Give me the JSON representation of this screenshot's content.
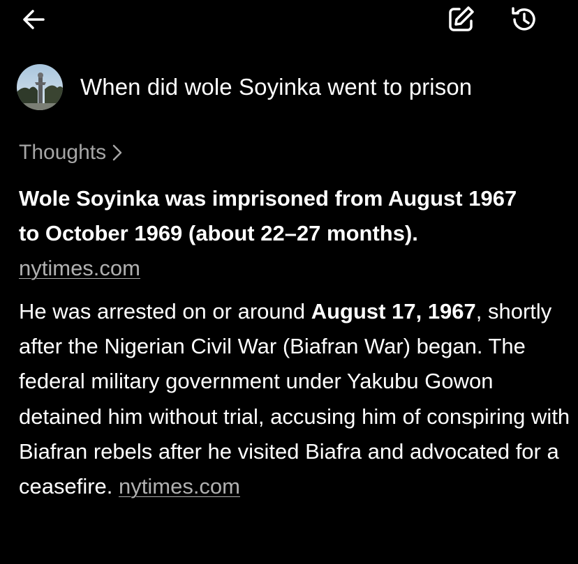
{
  "header": {
    "back_icon": "arrow-left-icon",
    "edit_icon": "edit-square-icon",
    "history_icon": "history-icon"
  },
  "query": {
    "text": "When did wole Soyinka went to prison"
  },
  "thoughts": {
    "label": "Thoughts",
    "icon": "chevron-right-icon"
  },
  "answer": {
    "summary_line1": "Wole Soyinka was imprisoned from August 1967",
    "summary_line2": "to October 1969 (about 22–27 months).",
    "summary_source": "nytimes.com",
    "p1_pre": "He was arrested on or around ",
    "p1_bold": "August 17, 1967",
    "p1_post": ", shortly after the Nigerian Civil War (Biafran War) began. The federal military government under Yakubu Gowon detained him without trial, accusing him of conspiring with Biafran rebels after he visited Biafra and advocated for a ceasefire. ",
    "p1_source": "nytimes.com"
  },
  "colors": {
    "background": "#000000",
    "text": "#ffffff",
    "muted": "#a6a6a6",
    "link": "#b0b0b0"
  }
}
